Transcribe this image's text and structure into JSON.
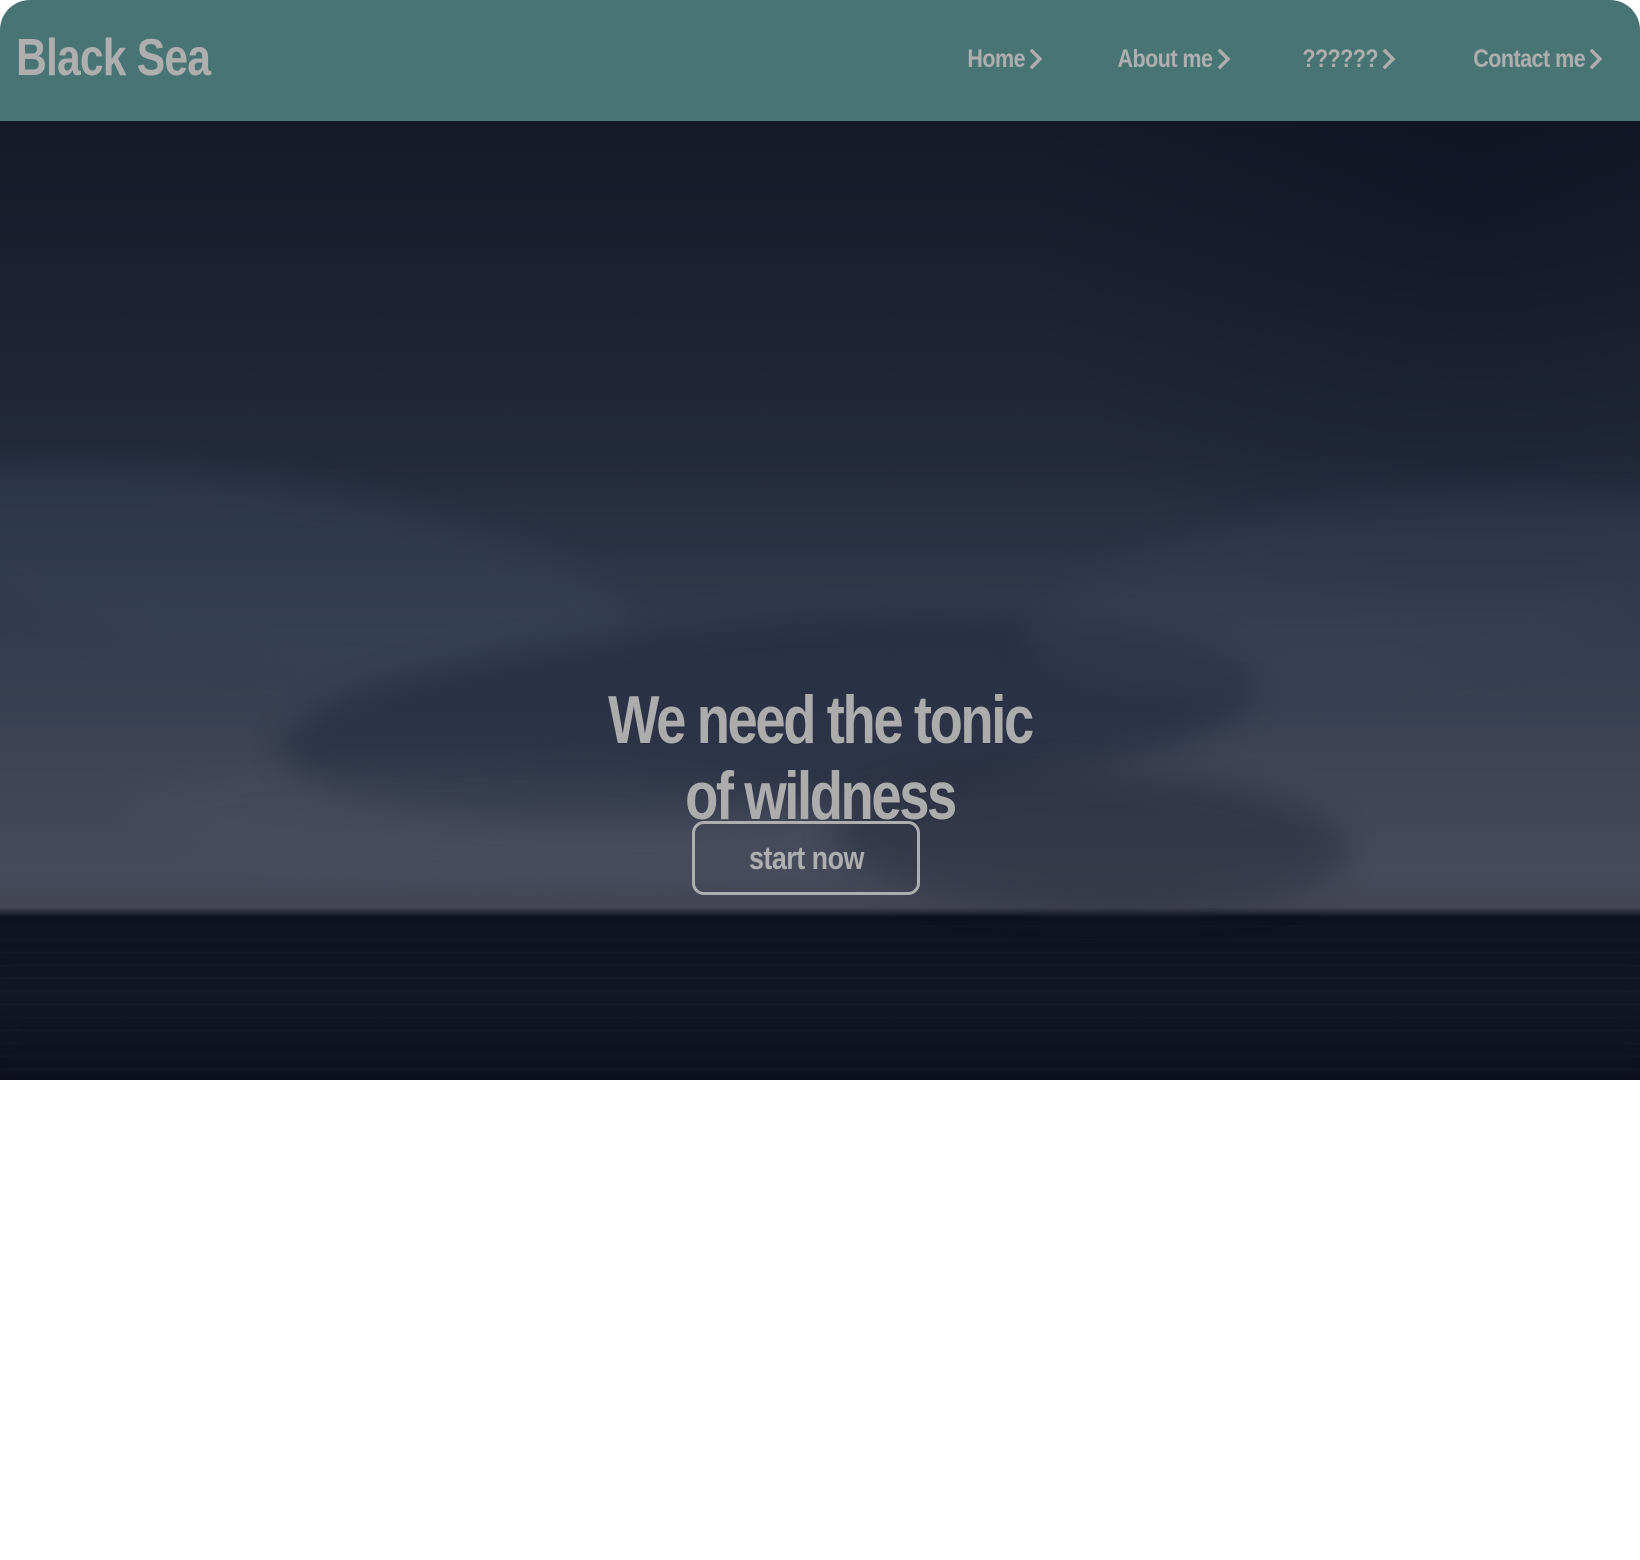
{
  "brand": {
    "name": "Black Sea"
  },
  "nav": {
    "items": [
      {
        "label": "Home",
        "icon": "chevron-right-icon"
      },
      {
        "label": "About me",
        "icon": "chevron-right-icon"
      },
      {
        "label": "??????",
        "icon": "chevron-right-icon"
      },
      {
        "label": "Contact me",
        "icon": "chevron-right-icon"
      }
    ]
  },
  "hero": {
    "title": "We need the tonic\nof wildness",
    "button_label": "start now"
  },
  "colors": {
    "navbar": "#487574",
    "text": "#aeaeae",
    "hero_dark": "#0c101f",
    "page_background": "#ffffff"
  }
}
